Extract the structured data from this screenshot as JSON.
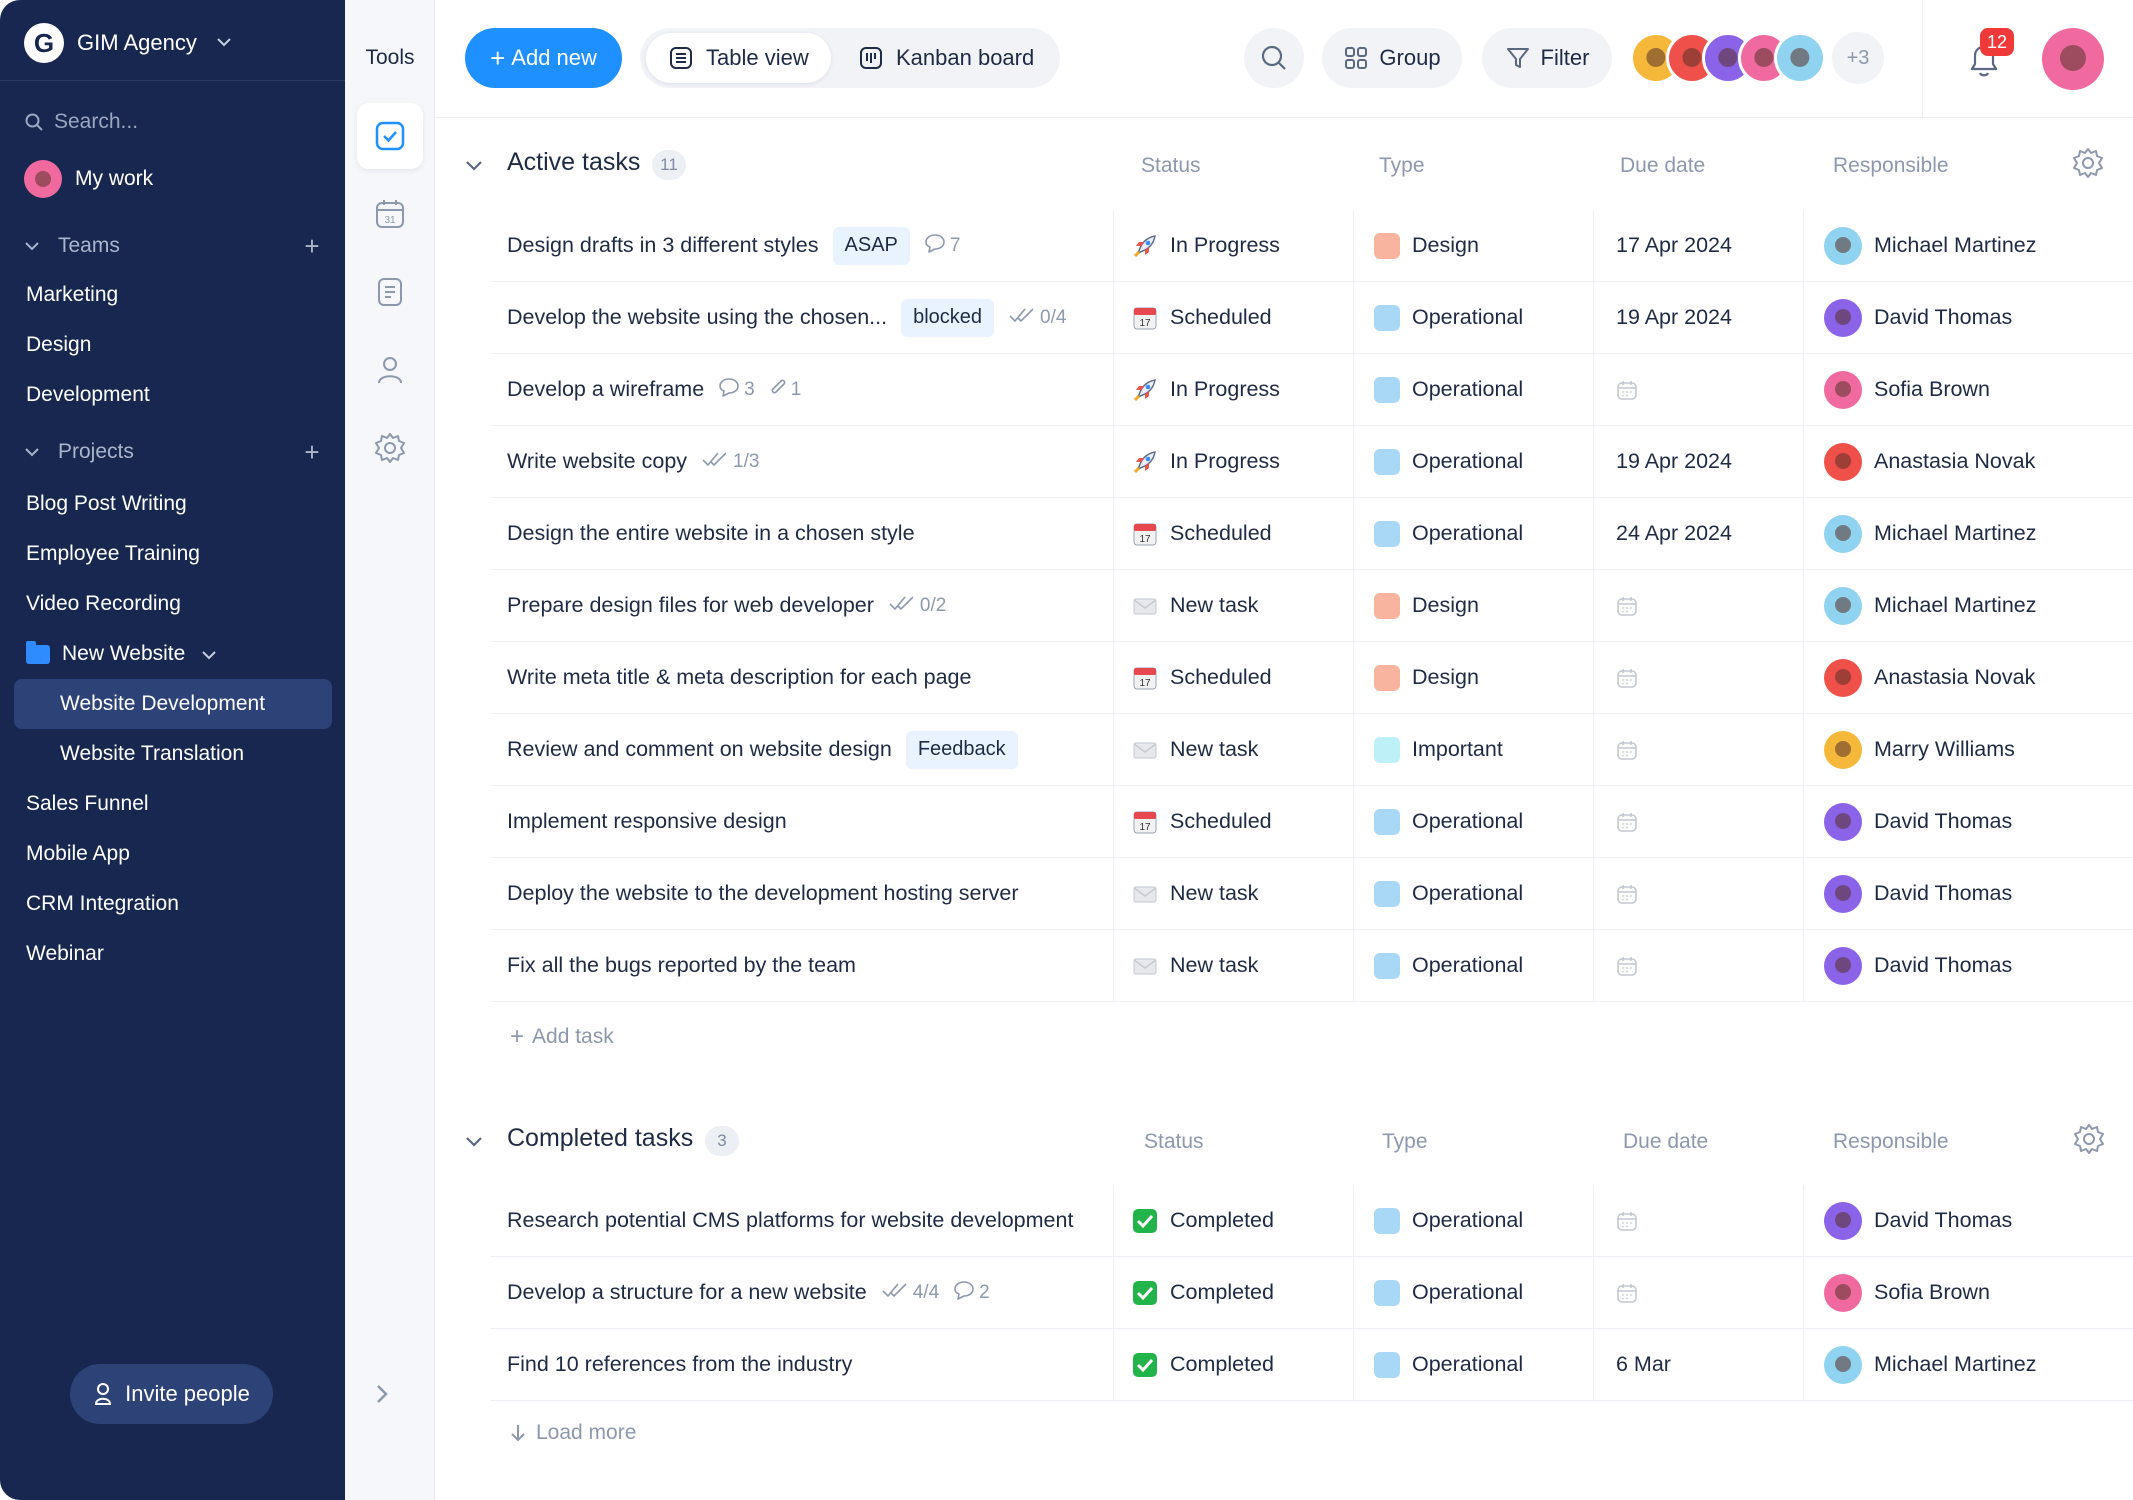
{
  "workspace": {
    "name": "GIM Agency",
    "logo_letter": "G"
  },
  "sidebar": {
    "search_placeholder": "Search...",
    "my_work": "My work",
    "teams_label": "Teams",
    "teams": [
      "Marketing",
      "Design",
      "Development"
    ],
    "projects_label": "Projects",
    "projects": [
      {
        "label": "Blog Post Writing"
      },
      {
        "label": "Employee Training"
      },
      {
        "label": "Video Recording"
      },
      {
        "label": "New Website",
        "folder": true
      },
      {
        "label": "Website Development",
        "sub": true,
        "active": true
      },
      {
        "label": "Website Translation",
        "sub": true
      },
      {
        "label": "Sales Funnel"
      },
      {
        "label": "Mobile App"
      },
      {
        "label": "CRM Integration"
      },
      {
        "label": "Webinar"
      }
    ],
    "invite_label": "Invite people"
  },
  "tools": {
    "title": "Tools",
    "items": [
      "tasks-icon",
      "calendar-icon",
      "docs-icon",
      "people-icon",
      "settings-icon"
    ],
    "calendar_day": "31"
  },
  "toolbar": {
    "add_new": "Add new",
    "table_view": "Table view",
    "kanban_board": "Kanban board",
    "group": "Group",
    "filter": "Filter",
    "more_members": "+3",
    "notifications_count": "12"
  },
  "colors": {
    "sidebar": "#172750",
    "accent": "#1e90ff",
    "type_design": "#f9b4a0",
    "type_operational": "#a9d8f7",
    "type_important": "#bdf0f7",
    "completed": "#22b34a",
    "badge": "#f03a3a"
  },
  "columns": {
    "status": "Status",
    "type": "Type",
    "due": "Due date",
    "responsible": "Responsible"
  },
  "active": {
    "title": "Active tasks",
    "count": "11",
    "rows": [
      {
        "task": "Design drafts in 3 different styles",
        "tag": "ASAP",
        "comments": "7",
        "status": "In Progress",
        "status_icon": "rocket",
        "type": "Design",
        "due": "17 Apr 2024",
        "resp": "Michael Martinez",
        "av": "#8fd3f0"
      },
      {
        "task": "Develop the website using the chosen...",
        "tag": "blocked",
        "checks": "0/4",
        "status": "Scheduled",
        "status_icon": "calendar",
        "type": "Operational",
        "due": "19 Apr 2024",
        "resp": "David Thomas",
        "av": "#8a63e8"
      },
      {
        "task": "Develop a wireframe",
        "comments": "3",
        "attachments": "1",
        "status": "In Progress",
        "status_icon": "rocket",
        "type": "Operational",
        "due": "",
        "resp": "Sofia Brown",
        "av": "#f06aa0"
      },
      {
        "task": "Write website copy",
        "checks": "1/3",
        "status": "In Progress",
        "status_icon": "rocket",
        "type": "Operational",
        "due": "19 Apr 2024",
        "resp": "Anastasia Novak",
        "av": "#f0504a"
      },
      {
        "task": "Design the entire website in a chosen style",
        "status": "Scheduled",
        "status_icon": "calendar",
        "type": "Operational",
        "due": "24 Apr 2024",
        "resp": "Michael Martinez",
        "av": "#8fd3f0"
      },
      {
        "task": "Prepare design files for web developer",
        "checks": "0/2",
        "status": "New task",
        "status_icon": "envelope",
        "type": "Design",
        "due": "",
        "resp": "Michael Martinez",
        "av": "#8fd3f0"
      },
      {
        "task": "Write meta title & meta description for each page",
        "status": "Scheduled",
        "status_icon": "calendar",
        "type": "Design",
        "due": "",
        "resp": "Anastasia Novak",
        "av": "#f0504a"
      },
      {
        "task": "Review and comment on website design",
        "tag": "Feedback",
        "status": "New task",
        "status_icon": "envelope",
        "type": "Important",
        "due": "",
        "resp": "Marry Williams",
        "av": "#f5b83a"
      },
      {
        "task": "Implement responsive design",
        "status": "Scheduled",
        "status_icon": "calendar",
        "type": "Operational",
        "due": "",
        "resp": "David Thomas",
        "av": "#8a63e8"
      },
      {
        "task": "Deploy the website to the development hosting server",
        "status": "New task",
        "status_icon": "envelope",
        "type": "Operational",
        "due": "",
        "resp": "David Thomas",
        "av": "#8a63e8"
      },
      {
        "task": "Fix all the bugs reported by the team",
        "status": "New task",
        "status_icon": "envelope",
        "type": "Operational",
        "due": "",
        "resp": "David Thomas",
        "av": "#8a63e8"
      }
    ],
    "add_task": "Add task"
  },
  "completed": {
    "title": "Completed tasks",
    "count": "3",
    "rows": [
      {
        "task": "Research potential CMS platforms for website development",
        "status": "Completed",
        "status_icon": "check",
        "type": "Operational",
        "due": "",
        "resp": "David Thomas",
        "av": "#8a63e8"
      },
      {
        "task": "Develop a structure for a new website",
        "checks": "4/4",
        "comments": "2",
        "status": "Completed",
        "status_icon": "check",
        "type": "Operational",
        "due": "",
        "resp": "Sofia Brown",
        "av": "#f06aa0"
      },
      {
        "task": "Find 10 references from the industry",
        "status": "Completed",
        "status_icon": "check",
        "type": "Operational",
        "due": "6 Mar",
        "resp": "Michael Martinez",
        "av": "#8fd3f0"
      }
    ],
    "load_more": "Load more"
  }
}
